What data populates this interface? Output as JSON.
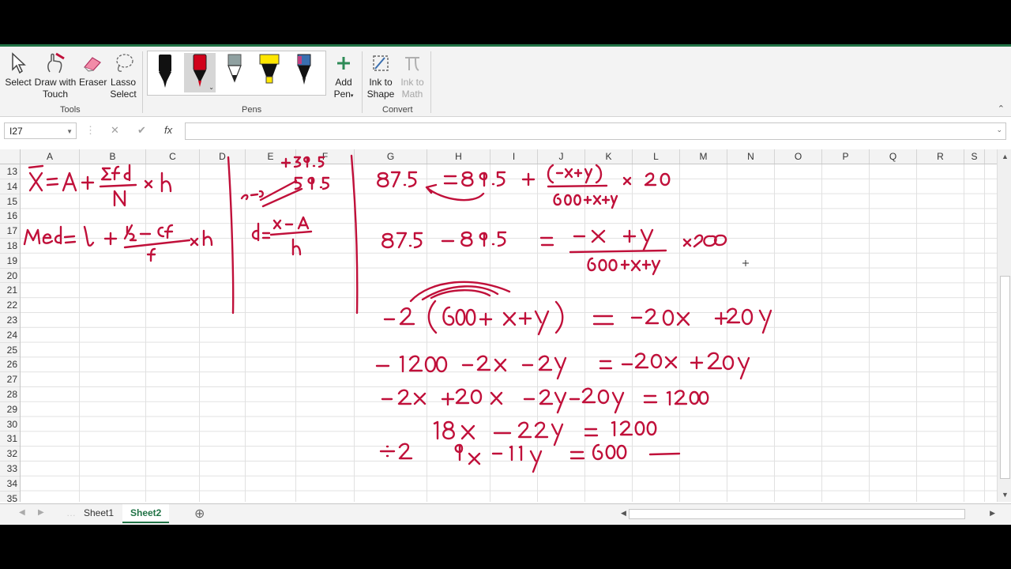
{
  "ribbon": {
    "tools": [
      {
        "label1": "Select",
        "label2": ""
      },
      {
        "label1": "Draw with",
        "label2": "Touch"
      },
      {
        "label1": "Eraser",
        "label2": ""
      },
      {
        "label1": "Lasso",
        "label2": "Select"
      }
    ],
    "group_tools": "Tools",
    "group_pens": "Pens",
    "add_pen": {
      "label1": "Add",
      "label2": "Pen"
    },
    "ink_to_shape": {
      "label1": "Ink to",
      "label2": "Shape"
    },
    "ink_to_math": {
      "label1": "Ink to",
      "label2": "Math"
    },
    "group_convert": "Convert",
    "pen_colors": [
      "#111111",
      "#d0021b",
      "#2a2a2a",
      "#ffe600",
      "#1a1a1a"
    ]
  },
  "formula_bar": {
    "name_box": "I27",
    "cancel": "✕",
    "enter": "✔",
    "fx": "fx",
    "value": ""
  },
  "columns": [
    "A",
    "B",
    "C",
    "D",
    "E",
    "F",
    "G",
    "H",
    "I",
    "J",
    "K",
    "L",
    "M",
    "N",
    "O",
    "P",
    "Q",
    "R",
    "S"
  ],
  "rows": [
    "13",
    "14",
    "15",
    "16",
    "17",
    "18",
    "19",
    "20",
    "21",
    "22",
    "23",
    "24",
    "25",
    "26",
    "27",
    "28",
    "29",
    "30",
    "31",
    "32",
    "33",
    "34",
    "35"
  ],
  "ink": {
    "color": "#c0103a",
    "notes": [
      "X = A + Σfd/N × h",
      "Med = l + (N/2 − cf)/f × h",
      "d = (x − A)/h",
      "+39.5",
      "59.5",
      "87.5 = 89.5 + (−x+y)/(600+x+y) × 20",
      "87.5 − 89.5 = (−x + y)/(600+x+y) × 20",
      "−2(600 + x + y) = −20x + 20y",
      "−1200 − 2x − 2y = −20x + 20y",
      "−2x + 20x − 2y − 20y = 1200",
      "18x − 22y = 1200",
      "÷2",
      "9x − 11y = 600"
    ]
  },
  "sheets": [
    {
      "label": "Sheet1",
      "active": false
    },
    {
      "label": "Sheet2",
      "active": true
    }
  ],
  "add_sheet": "⊕"
}
